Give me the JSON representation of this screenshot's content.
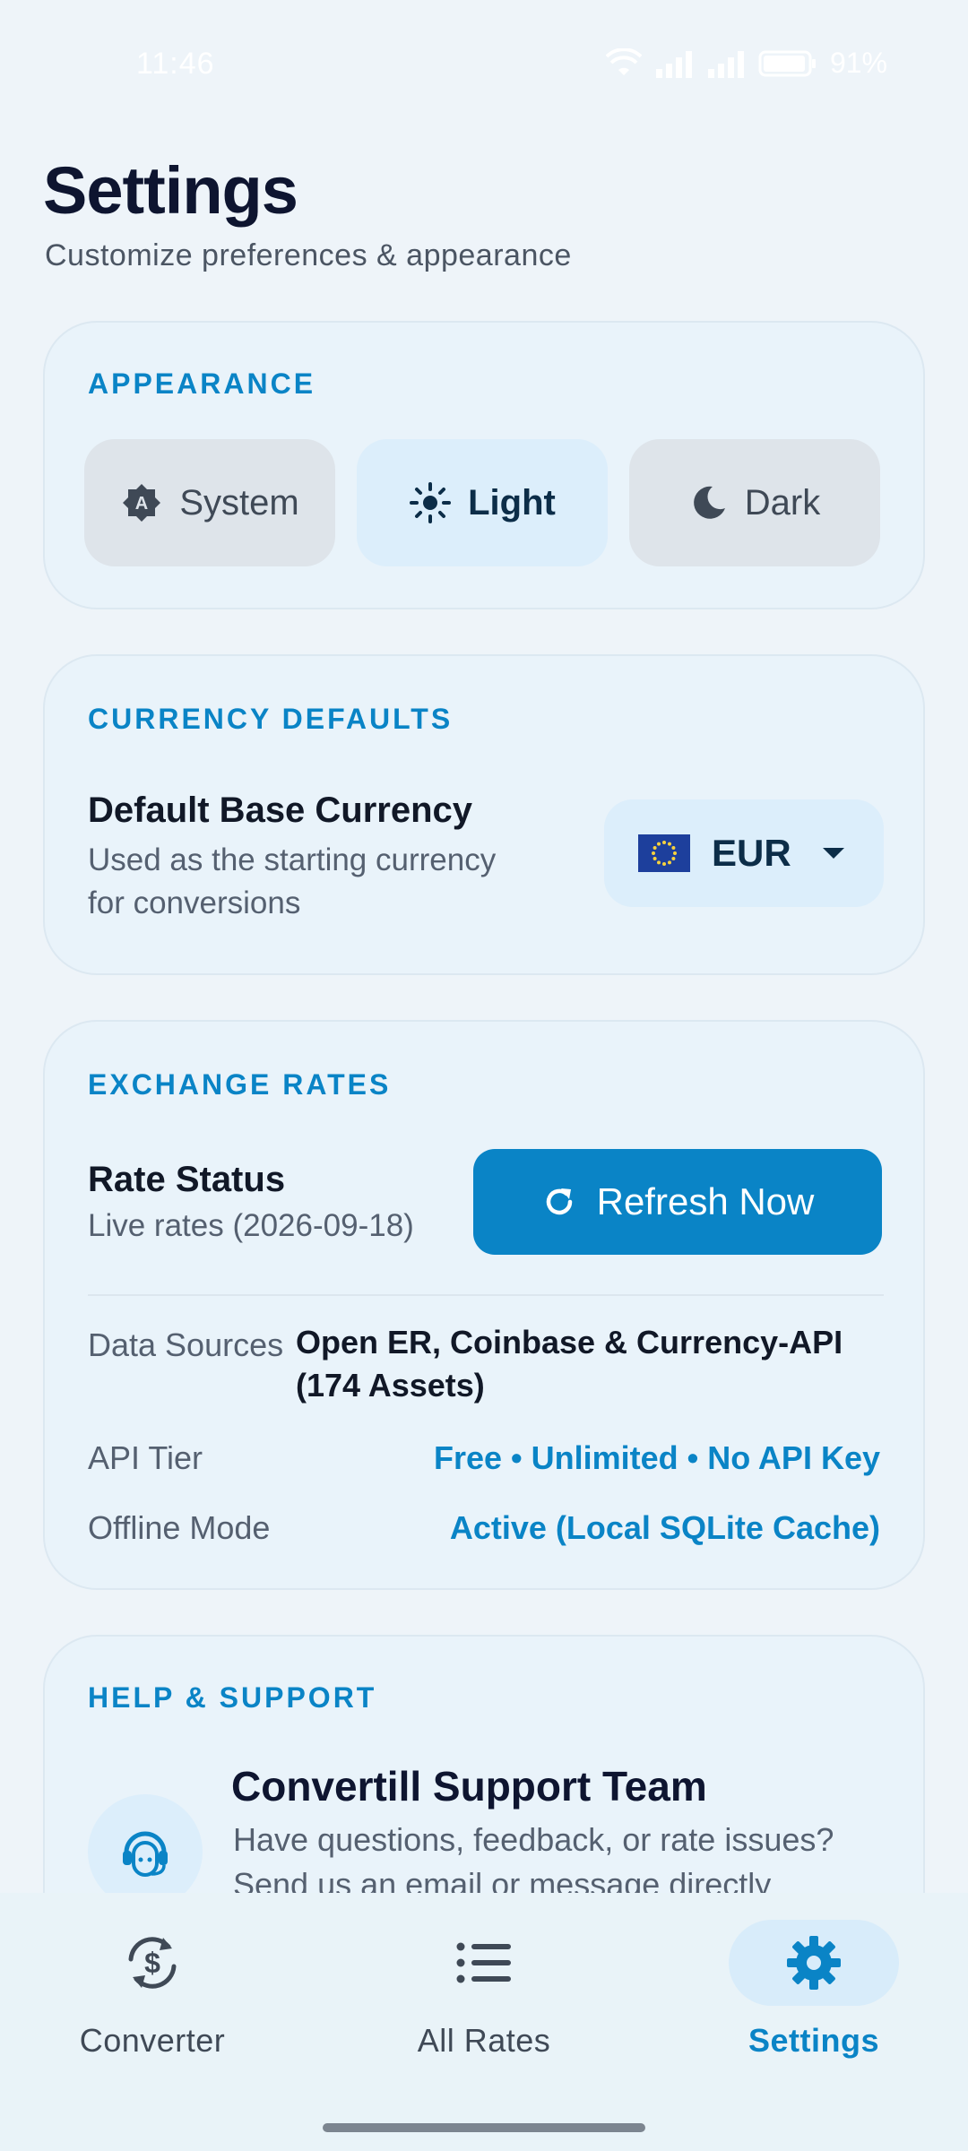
{
  "status_bar": {
    "time": "11:46",
    "battery": "91%",
    "icons": [
      "wifi-icon",
      "signal-icon",
      "signal-icon",
      "battery-icon"
    ]
  },
  "header": {
    "title": "Settings",
    "subtitle": "Customize preferences & appearance"
  },
  "appearance": {
    "label": "APPEARANCE",
    "options": [
      {
        "label": "System",
        "icon": "auto-brightness-icon",
        "selected": false
      },
      {
        "label": "Light",
        "icon": "sun-icon",
        "selected": true
      },
      {
        "label": "Dark",
        "icon": "moon-icon",
        "selected": false
      }
    ]
  },
  "currency": {
    "label": "CURRENCY DEFAULTS",
    "title": "Default Base Currency",
    "description_line1": "Used as the starting currency",
    "description_line2": "for conversions",
    "selected_code": "EUR",
    "flag_icon": "eu-flag-icon"
  },
  "rates": {
    "label": "EXCHANGE RATES",
    "status_title": "Rate Status",
    "status_desc": "Live rates (2026-09-18)",
    "refresh_label": "Refresh Now",
    "data_sources_label": "Data Sources",
    "data_sources_line1": "Open ER, Coinbase & Currency-API",
    "data_sources_line2": "(174 Assets)",
    "api_tier_label": "API Tier",
    "api_tier_value": "Free • Unlimited • No API Key",
    "offline_label": "Offline Mode",
    "offline_value": "Active (Local SQLite Cache)"
  },
  "help": {
    "label": "HELP & SUPPORT",
    "title": "Convertill Support Team",
    "line1": "Have questions, feedback, or rate issues?",
    "line2": "Send us an email or message directly"
  },
  "nav": {
    "items": [
      {
        "label": "Converter",
        "icon": "currency-exchange-icon",
        "active": false
      },
      {
        "label": "All Rates",
        "icon": "list-icon",
        "active": false
      },
      {
        "label": "Settings",
        "icon": "gear-icon",
        "active": true
      }
    ]
  },
  "colors": {
    "accent": "#0A84C6",
    "background": "#EEF4F9",
    "card": "#E9F3FA"
  }
}
